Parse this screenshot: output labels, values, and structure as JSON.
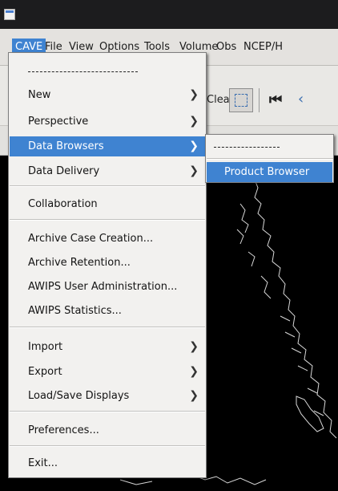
{
  "menubar": {
    "items": [
      {
        "label": "CAVE",
        "active": true
      },
      {
        "label": "File"
      },
      {
        "label": "View"
      },
      {
        "label": "Options"
      },
      {
        "label": "Tools"
      },
      {
        "label": "Volume"
      },
      {
        "label": "Obs"
      },
      {
        "label": "NCEP/H"
      }
    ]
  },
  "toolbar": {
    "clear_label": "Clear",
    "first_frame_glyph": "⏮",
    "prev_frame_glyph": "‹"
  },
  "cave_menu": {
    "tearoff": "------------------------",
    "items": [
      {
        "label": "New",
        "submenu": true
      },
      {
        "label": "Perspective",
        "submenu": true
      },
      {
        "label": "Data Browsers",
        "submenu": true,
        "highlighted": true
      },
      {
        "label": "Data Delivery",
        "submenu": true
      },
      {
        "label": "Collaboration"
      },
      {
        "label": "Archive Case Creation..."
      },
      {
        "label": "Archive Retention..."
      },
      {
        "label": "AWIPS User Administration..."
      },
      {
        "label": "AWIPS Statistics..."
      },
      {
        "label": "Import",
        "submenu": true
      },
      {
        "label": "Export",
        "submenu": true
      },
      {
        "label": "Load/Save Displays",
        "submenu": true
      },
      {
        "label": "Preferences..."
      },
      {
        "label": "Exit..."
      }
    ]
  },
  "data_browsers_submenu": {
    "tearoff": "---------------",
    "items": [
      {
        "label": "Product Browser",
        "highlighted": true
      }
    ]
  },
  "colors": {
    "highlight": "#3f83d1",
    "menu_bg": "#f2f1ef",
    "map_bg": "#000000",
    "coastline": "#d8d8d8"
  }
}
